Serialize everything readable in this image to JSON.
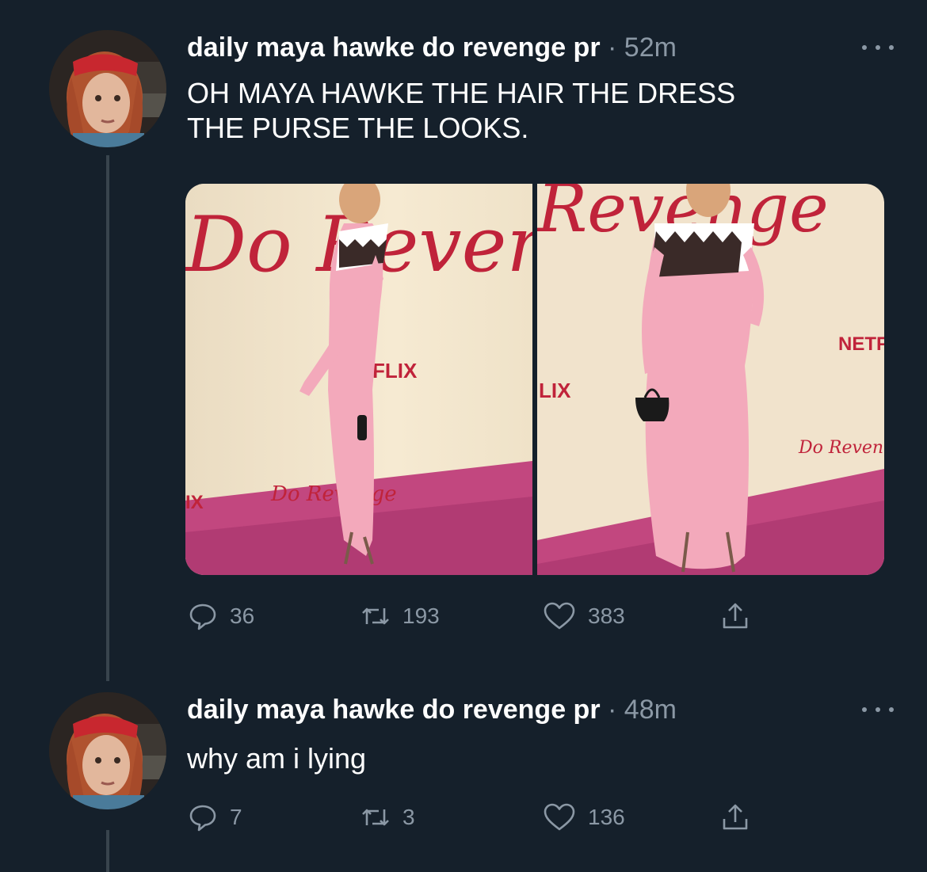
{
  "tweets": [
    {
      "display_name": "daily maya hawke do revenge pr",
      "separator": "·",
      "time": "52m",
      "text_lines": [
        "OH MAYA HAWKE THE HAIR THE DRESS",
        "THE PURSE THE LOOKS."
      ],
      "media": {
        "photo_1_text": {
          "logo": "Do Revenge",
          "brand": "FLIX",
          "brand2": "IX",
          "script": "Do Revenge"
        },
        "photo_2_text": {
          "logo": "Revenge",
          "brand": "LIX",
          "brand2": "NETF",
          "script": "Do Revenge"
        }
      },
      "stats": {
        "replies": "36",
        "retweets": "193",
        "likes": "383"
      }
    },
    {
      "display_name": "daily maya hawke do revenge pr",
      "separator": "·",
      "time": "48m",
      "text_lines": [
        "why am i lying"
      ],
      "stats": {
        "replies": "7",
        "retweets": "3",
        "likes": "136"
      }
    }
  ],
  "icons": {
    "reply": "speech-bubble-icon",
    "retweet": "retweet-arrows-icon",
    "like": "heart-icon",
    "share": "share-upload-icon",
    "more": "more-dots-icon"
  },
  "colors": {
    "background": "#15202b",
    "text": "#ffffff",
    "secondary": "#8b98a5",
    "thread_line": "#38444d",
    "backdrop": "#f1e3cc",
    "carpet": "#c2477f",
    "dress": "#f3a9bb",
    "logo_red": "#c0233a"
  }
}
